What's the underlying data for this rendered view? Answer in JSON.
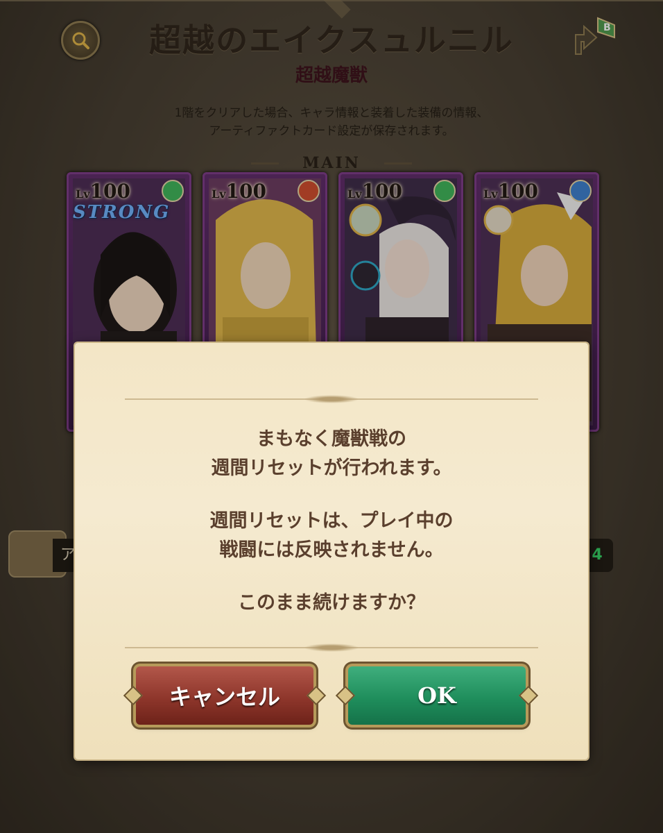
{
  "header": {
    "title": "超越のエイクスュルニル",
    "subtitle": "超越魔獣",
    "description_line1": "1階をクリアした場合、キャラ情報と装着した装備の情報、",
    "description_line2": "アーティファクトカード設定が保存されます。",
    "section_label": "MAIN"
  },
  "icons": {
    "search": "search-icon",
    "share": "share-badge-icon",
    "share_badge": "B"
  },
  "cards": [
    {
      "lv_prefix": "Lv",
      "level": "100",
      "element": "green",
      "badge": "STRONG"
    },
    {
      "lv_prefix": "Lv",
      "level": "100",
      "element": "red",
      "badge": ""
    },
    {
      "lv_prefix": "Lv",
      "level": "100",
      "element": "green",
      "badge": ""
    },
    {
      "lv_prefix": "Lv",
      "level": "100",
      "element": "blue",
      "badge": ""
    }
  ],
  "side": {
    "left_text": "ア",
    "right_text": "4"
  },
  "dialog": {
    "line1": "まもなく魔獣戦の",
    "line2": "週間リセットが行われます。",
    "line3": "週間リセットは、プレイ中の",
    "line4": "戦闘には反映されません。",
    "line5": "このまま続けますか？",
    "cancel_label": "キャンセル",
    "ok_label": "OK"
  },
  "colors": {
    "cancel": "#8e362b",
    "ok": "#1f8e5c",
    "element_green": "#3cb65a",
    "element_red": "#d14b2c",
    "element_blue": "#3a7fd0"
  }
}
